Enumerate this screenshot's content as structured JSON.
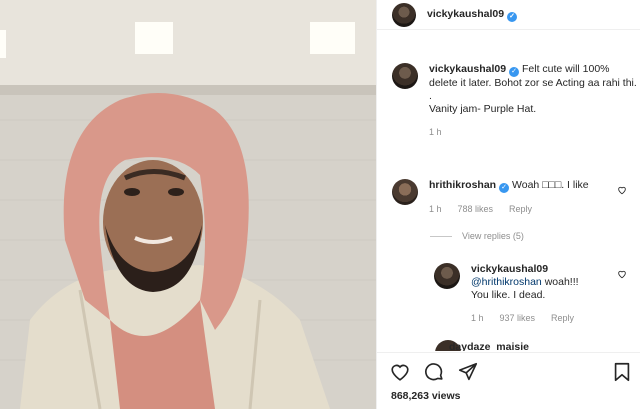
{
  "post_author": {
    "username": "vickykaushal09",
    "verified_icon": "verified-badge-icon"
  },
  "caption": {
    "username": "vickykaushal09",
    "line1": "Felt cute will 100% delete it later. Bohot zor se Acting aa rahi thi.",
    "line2": ".",
    "line3": "Vanity jam- Purple Hat.",
    "time": "1 h"
  },
  "comment1": {
    "username": "hrithikroshan",
    "text": "Woah □□□. I like",
    "time": "1 h",
    "likes": "788 likes",
    "reply": "Reply"
  },
  "view_replies": "View replies (5)",
  "reply1": {
    "username": "vickykaushal09",
    "mention": "@hrithikroshan",
    "text_after_mention": " woah!!!",
    "text2": "You like. I dead.",
    "time": "1 h",
    "likes": "937 likes",
    "reply": "Reply"
  },
  "partial_comment_username": "daydaze_maisie",
  "actions": {
    "like_icon": "heart-icon",
    "comment_icon": "comment-icon",
    "share_icon": "send-icon",
    "save_icon": "bookmark-icon"
  },
  "views": "868,263 views",
  "colors": {
    "verified": "#3897f0",
    "hoodie": "#d99a86",
    "jacket": "#e6e0d2",
    "wall": "#dcd8d0"
  }
}
